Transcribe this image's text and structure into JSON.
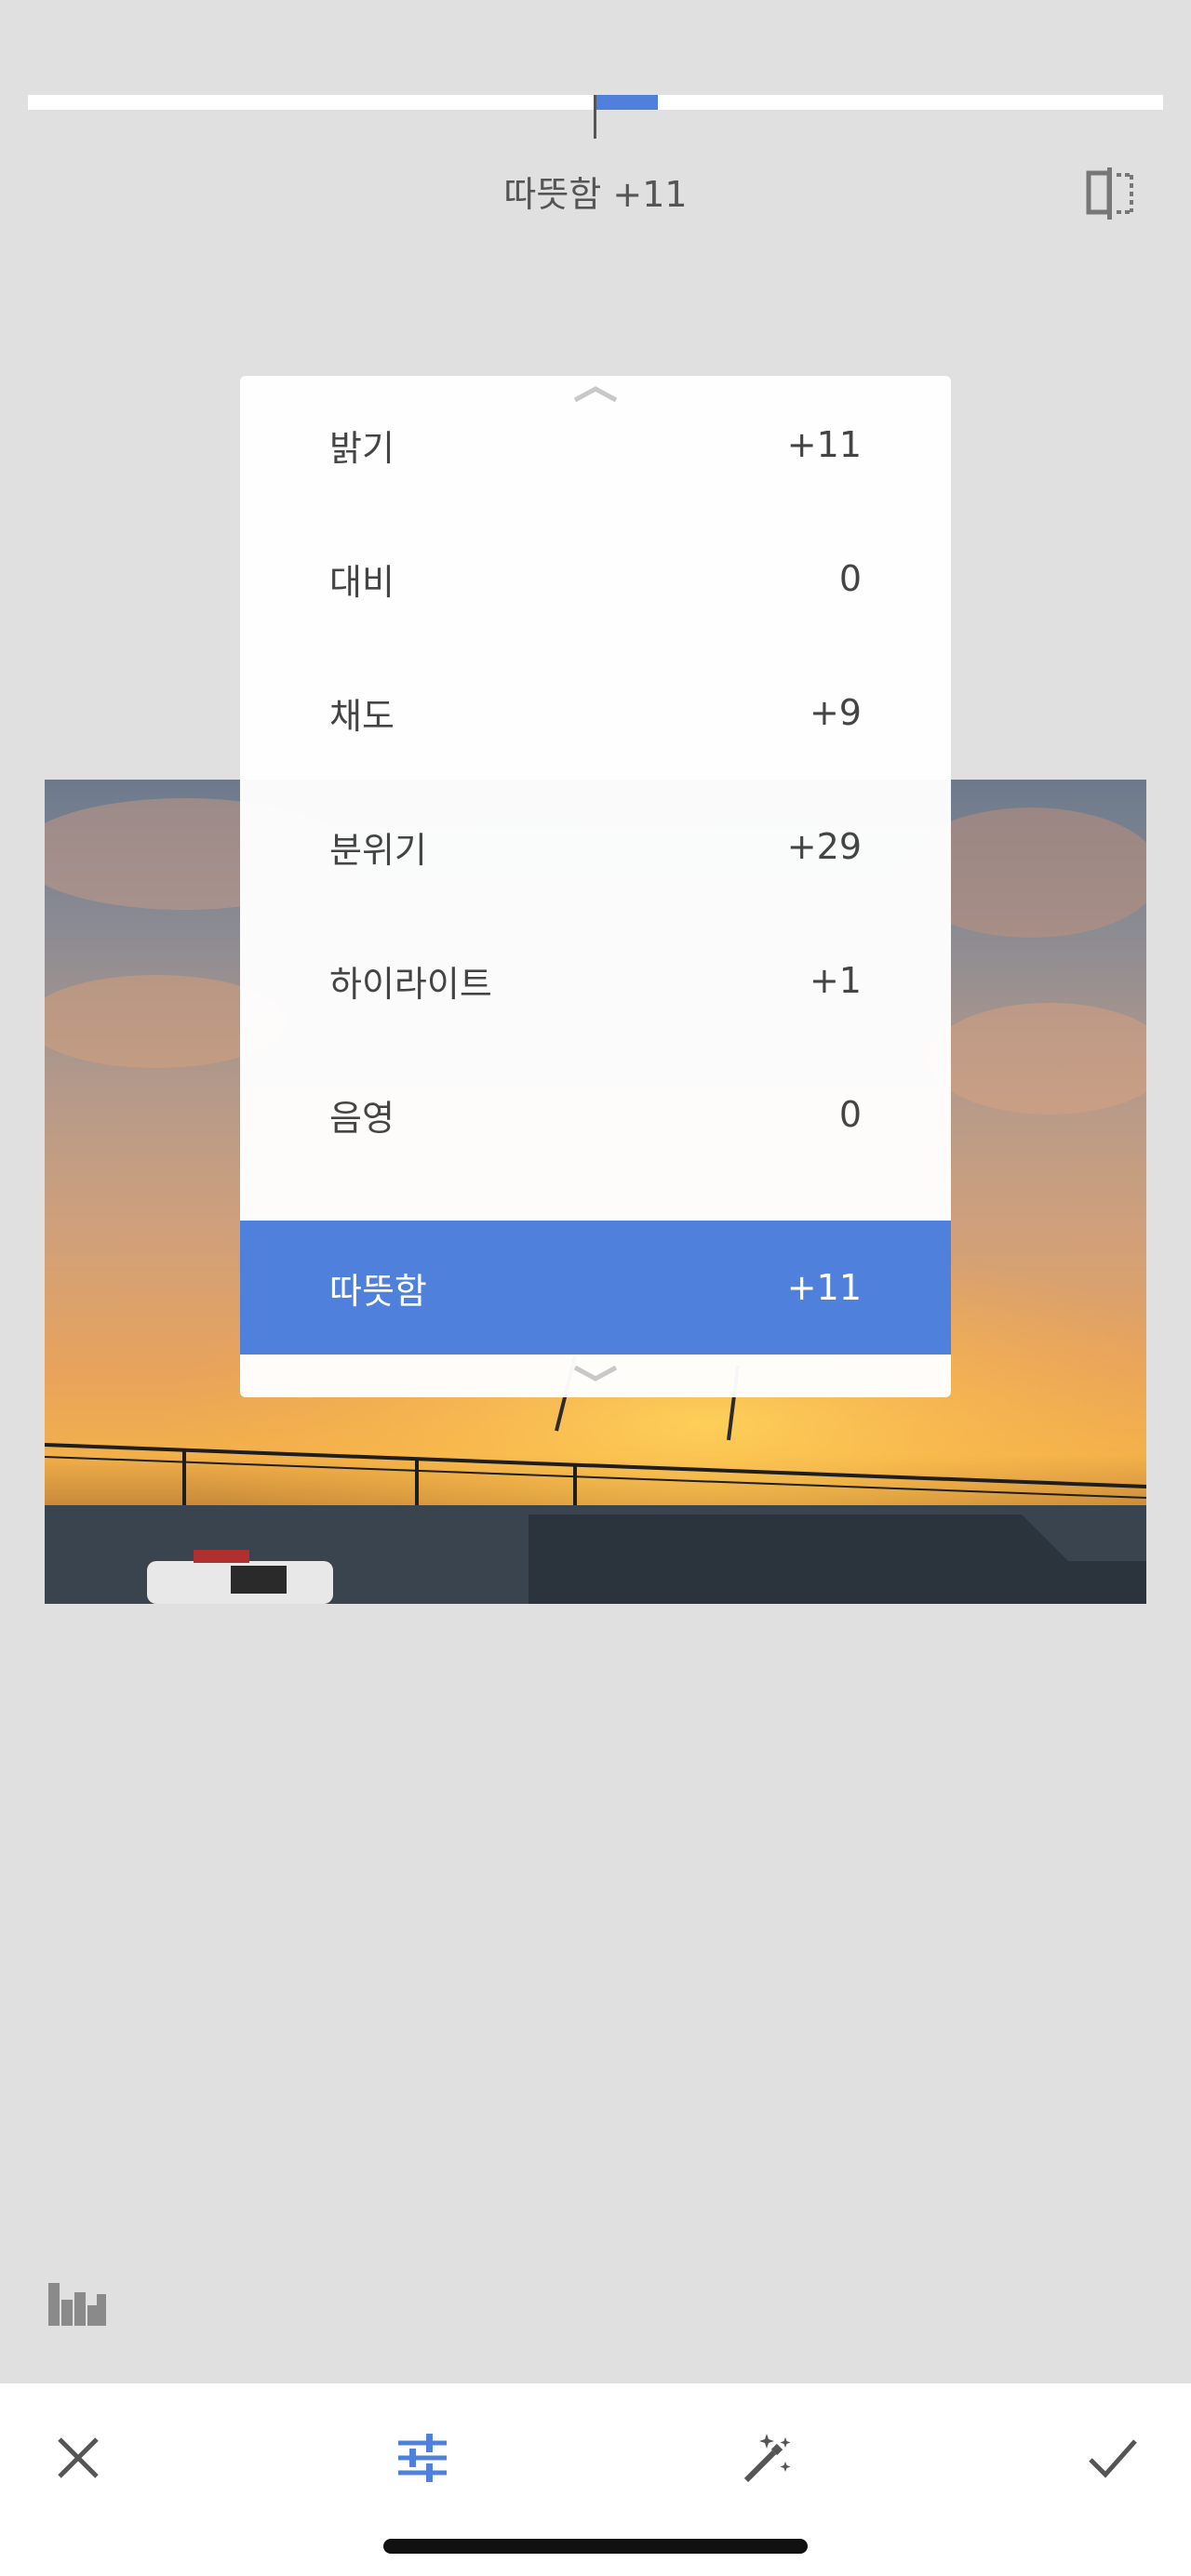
{
  "header": {
    "active_parameter_label": "따뜻함 +11",
    "compare_icon": "split-compare-icon"
  },
  "slider": {
    "value": 11,
    "accent_color": "#4f80dc"
  },
  "menu": {
    "items": [
      {
        "label": "밝기",
        "value": "+11"
      },
      {
        "label": "대비",
        "value": "0"
      },
      {
        "label": "채도",
        "value": "+9"
      },
      {
        "label": "분위기",
        "value": "+29"
      },
      {
        "label": "하이라이트",
        "value": "+1"
      },
      {
        "label": "음영",
        "value": "0"
      },
      {
        "label": "따뜻함",
        "value": "+11",
        "selected": true
      }
    ]
  },
  "toolbar": {
    "cancel_icon": "close-icon",
    "adjust_icon": "tune-sliders-icon",
    "auto_icon": "magic-wand-icon",
    "apply_icon": "checkmark-icon",
    "histogram_icon": "histogram-icon"
  }
}
